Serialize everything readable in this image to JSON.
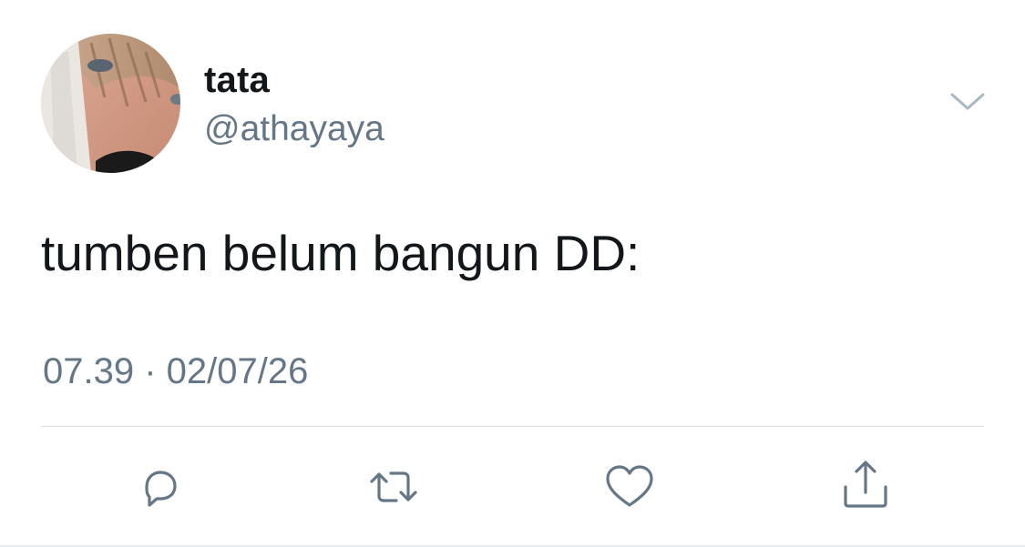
{
  "author": {
    "display_name": "tata",
    "handle": "@athayaya",
    "avatar": "profile-photo"
  },
  "tweet": {
    "text": "tumben belum bangun DD:",
    "timestamp": "07.39 · 02/07/26"
  },
  "actions": {
    "reply_icon": "reply-icon",
    "retweet_icon": "retweet-icon",
    "like_icon": "heart-icon",
    "share_icon": "share-icon",
    "more_icon": "chevron-down-icon"
  },
  "colors": {
    "text_primary": "#14171a",
    "text_secondary": "#657786",
    "icon": "#657786",
    "divider": "#d8dde2"
  }
}
